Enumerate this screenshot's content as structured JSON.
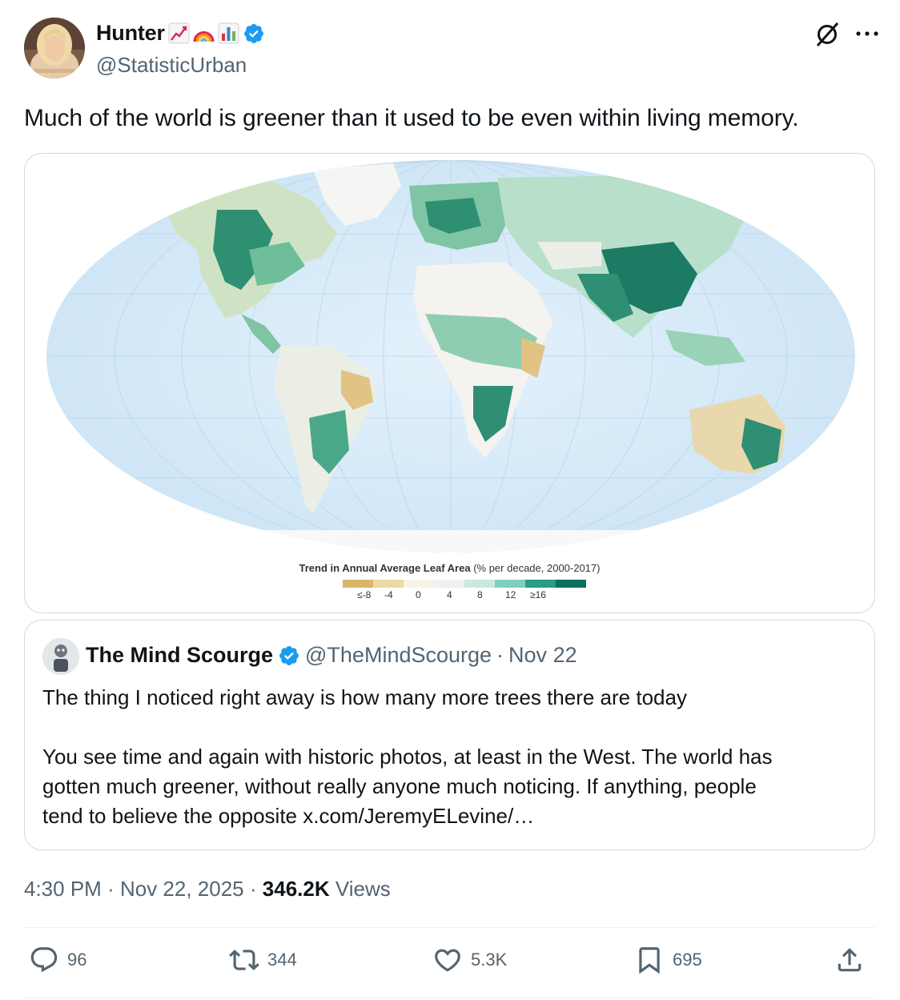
{
  "author": {
    "display_name": "Hunter",
    "emojis": [
      "chart-increasing",
      "rainbow",
      "bar-chart"
    ],
    "handle": "@StatisticUrban",
    "verified": true
  },
  "tweet": {
    "text": "Much of the world is greener than it used to be even within living memory."
  },
  "media": {
    "legend_title": "Trend in Annual Average Leaf Area",
    "legend_subtitle": "(% per decade, 2000-2017)",
    "legend_ticks": [
      "≤-8",
      "-4",
      "0",
      "4",
      "8",
      "12",
      "≥16"
    ],
    "legend_colors": [
      "#d9b66a",
      "#ecd9a6",
      "#f7f3e6",
      "#f3f5f3",
      "#c8e9e2",
      "#7fcfbd",
      "#2b9c86",
      "#0b6f5d"
    ]
  },
  "quote": {
    "display_name": "The Mind Scourge",
    "handle": "@TheMindScourge",
    "separator": "·",
    "date": "Nov 22",
    "line1": "The thing I noticed right away is how many more trees there are today",
    "line2": "You see time and again with historic photos, at least in the West. The world has",
    "line3": "gotten much greener, without really anyone much noticing. If anything, people",
    "line4": "tend to believe the opposite x.com/JeremyELevine/…"
  },
  "meta": {
    "time": "4:30 PM",
    "separator": "·",
    "date": "Nov 22, 2025",
    "views_count": "346.2K",
    "views_label": "Views"
  },
  "actions": {
    "replies": "96",
    "reposts": "344",
    "likes": "5.3K",
    "bookmarks": "695"
  },
  "colors": {
    "text_primary": "#0f1419",
    "text_secondary": "#536471",
    "verified_blue": "#1d9bf0",
    "border": "#cfd9de"
  },
  "icons": [
    "grok-icon",
    "more-icon",
    "verified-badge-icon",
    "reply-icon",
    "repost-icon",
    "like-icon",
    "bookmark-icon",
    "share-icon"
  ]
}
